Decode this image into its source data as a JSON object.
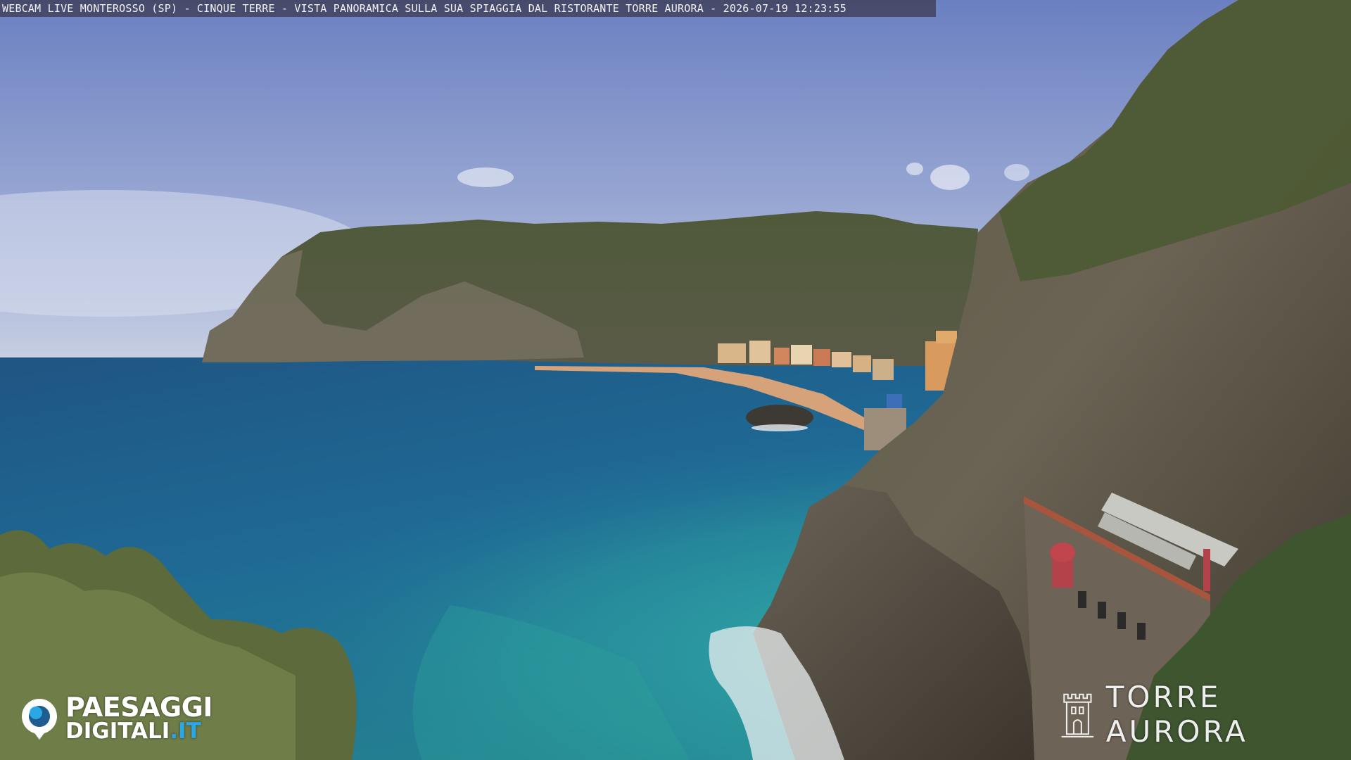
{
  "caption": {
    "text": "WEBCAM LIVE MONTEROSSO (SP) - CINQUE TERRE - VISTA PANORAMICA SULLA SUA SPIAGGIA DAL RISTORANTE TORRE AURORA - 2026-07-19 12:23:55"
  },
  "logo_left": {
    "icon": "camera-lens-icon",
    "line1": "PAESAGGI",
    "line2": "DIGITALI",
    "line2_suffix": ".IT",
    "accent_color": "#2aa8e6"
  },
  "logo_right": {
    "icon": "tower-icon",
    "name": "TORRE AURORA"
  },
  "colors": {
    "sky_top": "#6f84c4",
    "sky_horizon": "#c4cde4",
    "sea_deep": "#1d5f8e",
    "sea_turquoise": "#2a9ea4",
    "headland": "#4a5638",
    "cliff_rock": "#6e655a"
  }
}
